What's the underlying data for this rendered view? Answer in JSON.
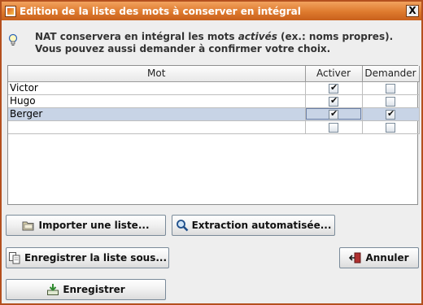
{
  "window": {
    "title": "Edition de la liste des mots à conserver en intégral",
    "close_label": "X"
  },
  "info": {
    "line1_prefix": "NAT conservera en intégral les mots ",
    "line1_emph": "activés",
    "line1_suffix": " (ex.: noms propres).",
    "line2": "Vous pouvez aussi demander à confirmer votre choix."
  },
  "table": {
    "headers": {
      "word": "Mot",
      "activate": "Activer",
      "ask": "Demander"
    },
    "rows": [
      {
        "word": "Victor",
        "activate": true,
        "ask": false
      },
      {
        "word": "Hugo",
        "activate": true,
        "ask": false
      },
      {
        "word": "Berger",
        "activate": true,
        "ask": true,
        "selected": true
      },
      {
        "word": "",
        "activate": false,
        "ask": false
      }
    ]
  },
  "buttons": {
    "import": "Importer une liste...",
    "extract": "Extraction automatisée...",
    "save_as": "Enregistrer la liste sous...",
    "cancel": "Annuler",
    "save": "Enregistrer"
  },
  "icons": {
    "app": "app-icon",
    "close": "close-icon",
    "info": "lightbulb-icon",
    "import": "folder-icon",
    "extract": "magnifier-icon",
    "save_as": "documents-icon",
    "cancel": "exit-icon",
    "save": "save-download-icon"
  },
  "colors": {
    "title_bar": "#de7a2e",
    "selected_row": "#c8d4e6",
    "background": "#eeeeee"
  }
}
